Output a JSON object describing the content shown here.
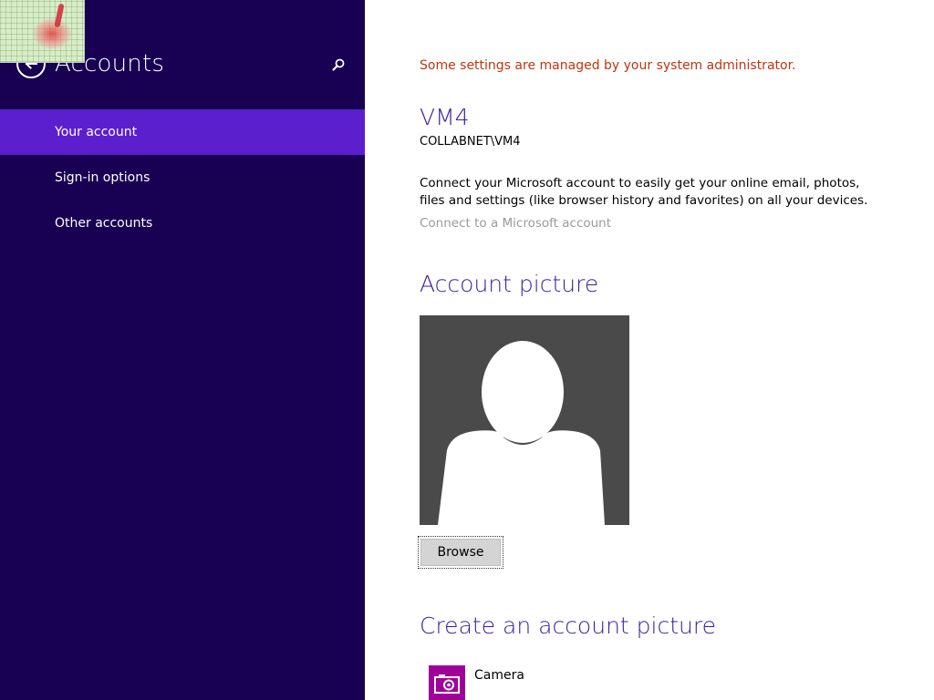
{
  "sidebar": {
    "title": "Accounts",
    "back_icon": "back-arrow-icon",
    "search_icon": "search-icon",
    "items": [
      {
        "label": "Your account",
        "selected": true
      },
      {
        "label": "Sign-in options",
        "selected": false
      },
      {
        "label": "Other accounts",
        "selected": false
      }
    ]
  },
  "main": {
    "admin_note": "Some settings are managed by your system administrator.",
    "user": {
      "name": "VM4",
      "domain": "COLLABNET\\VM4"
    },
    "connect": {
      "description": "Connect your Microsoft account to easily get your online email, photos, files and settings (like browser history and favorites) on all your devices.",
      "link": "Connect to a Microsoft account"
    },
    "account_picture": {
      "heading": "Account picture",
      "avatar_icon": "default-user-avatar-icon",
      "browse_label": "Browse"
    },
    "create_picture": {
      "heading": "Create an account picture",
      "apps": [
        {
          "label": "Camera",
          "icon": "camera-icon"
        }
      ]
    }
  },
  "colors": {
    "sidebar_bg": "#180052",
    "selected_item_bg": "#5c1fce",
    "heading": "#3c1e9c",
    "admin_note": "#c2340e",
    "link_disabled": "#9a9a9a",
    "avatar_bg": "#4a4a4a",
    "camera_tile": "#a0009a"
  }
}
